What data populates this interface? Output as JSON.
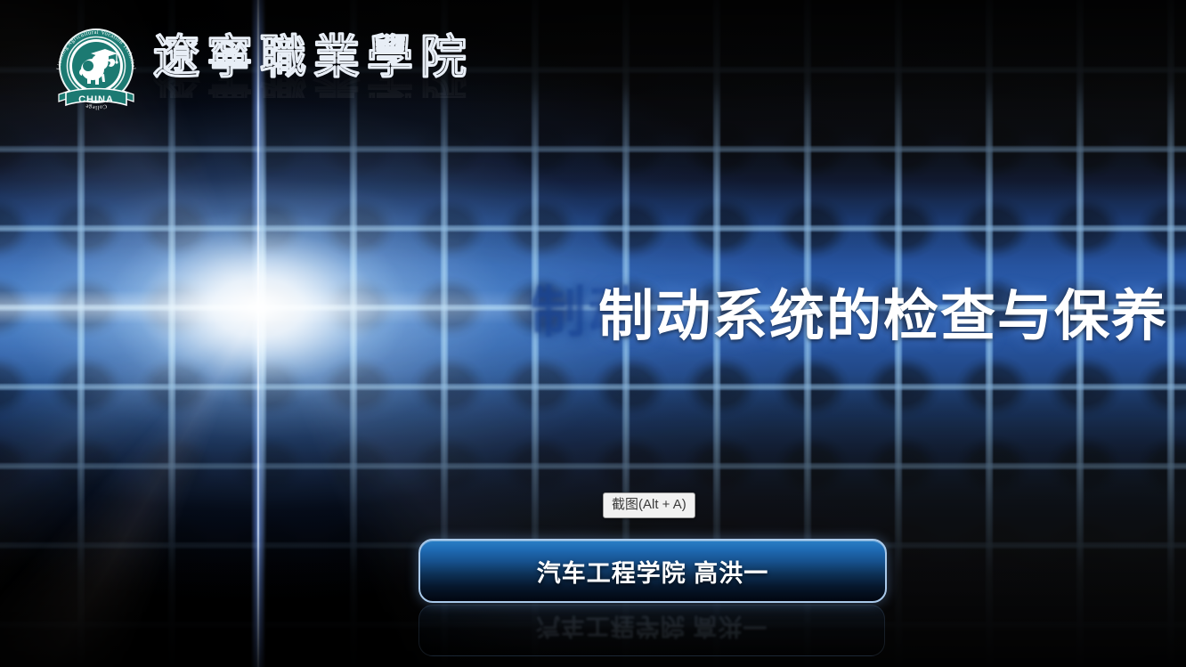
{
  "slide": {
    "title": "制动系统的检查与保养",
    "title_ghost": "制动",
    "presenter": "汽车工程学院  高洪一",
    "presenter_reflection": "汽车工程学院  高洪一"
  },
  "logo": {
    "crest_ring_text": "Liaoning Agricultural Vocation Technical College",
    "crest_banner_text": "CHINA",
    "crest_color": "#1c7a72",
    "school_name": "遼寧職業學院",
    "school_name_chars": [
      "遼",
      "寧",
      "職",
      "業",
      "學",
      "院"
    ]
  },
  "tooltip": {
    "label": "截图(Alt + A)",
    "background": "#f1f1f1",
    "text_color": "#3a3a3a"
  },
  "theme": {
    "accent_blue": "#2359ad",
    "glow_white": "#ffffff",
    "button_border": "#a9c9ea",
    "button_top": "#2a7fc6",
    "background_black": "#000000"
  }
}
